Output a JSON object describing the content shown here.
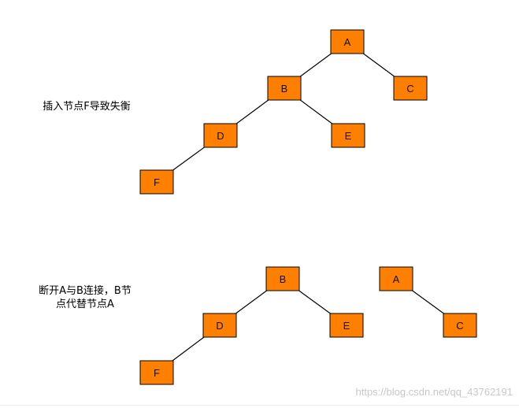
{
  "captions": {
    "before": "插入节点F导致失衡",
    "after_line1": "断开A与B连接，B节",
    "after_line2": "点代替节点A"
  },
  "watermark": "https://blog.csdn.net/qq_43762191",
  "colors": {
    "node_fill": "#ff8000",
    "node_stroke": "#000000",
    "edge": "#000000"
  },
  "tree_before": {
    "nodes": [
      "A",
      "B",
      "C",
      "D",
      "E",
      "F"
    ],
    "edges": [
      [
        "A",
        "B"
      ],
      [
        "A",
        "C"
      ],
      [
        "B",
        "D"
      ],
      [
        "B",
        "E"
      ],
      [
        "D",
        "F"
      ]
    ]
  },
  "tree_after": {
    "nodes": [
      "B",
      "D",
      "E",
      "F",
      "A",
      "C"
    ],
    "edges": [
      [
        "B",
        "D"
      ],
      [
        "B",
        "E"
      ],
      [
        "D",
        "F"
      ],
      [
        "A",
        "C"
      ]
    ]
  }
}
